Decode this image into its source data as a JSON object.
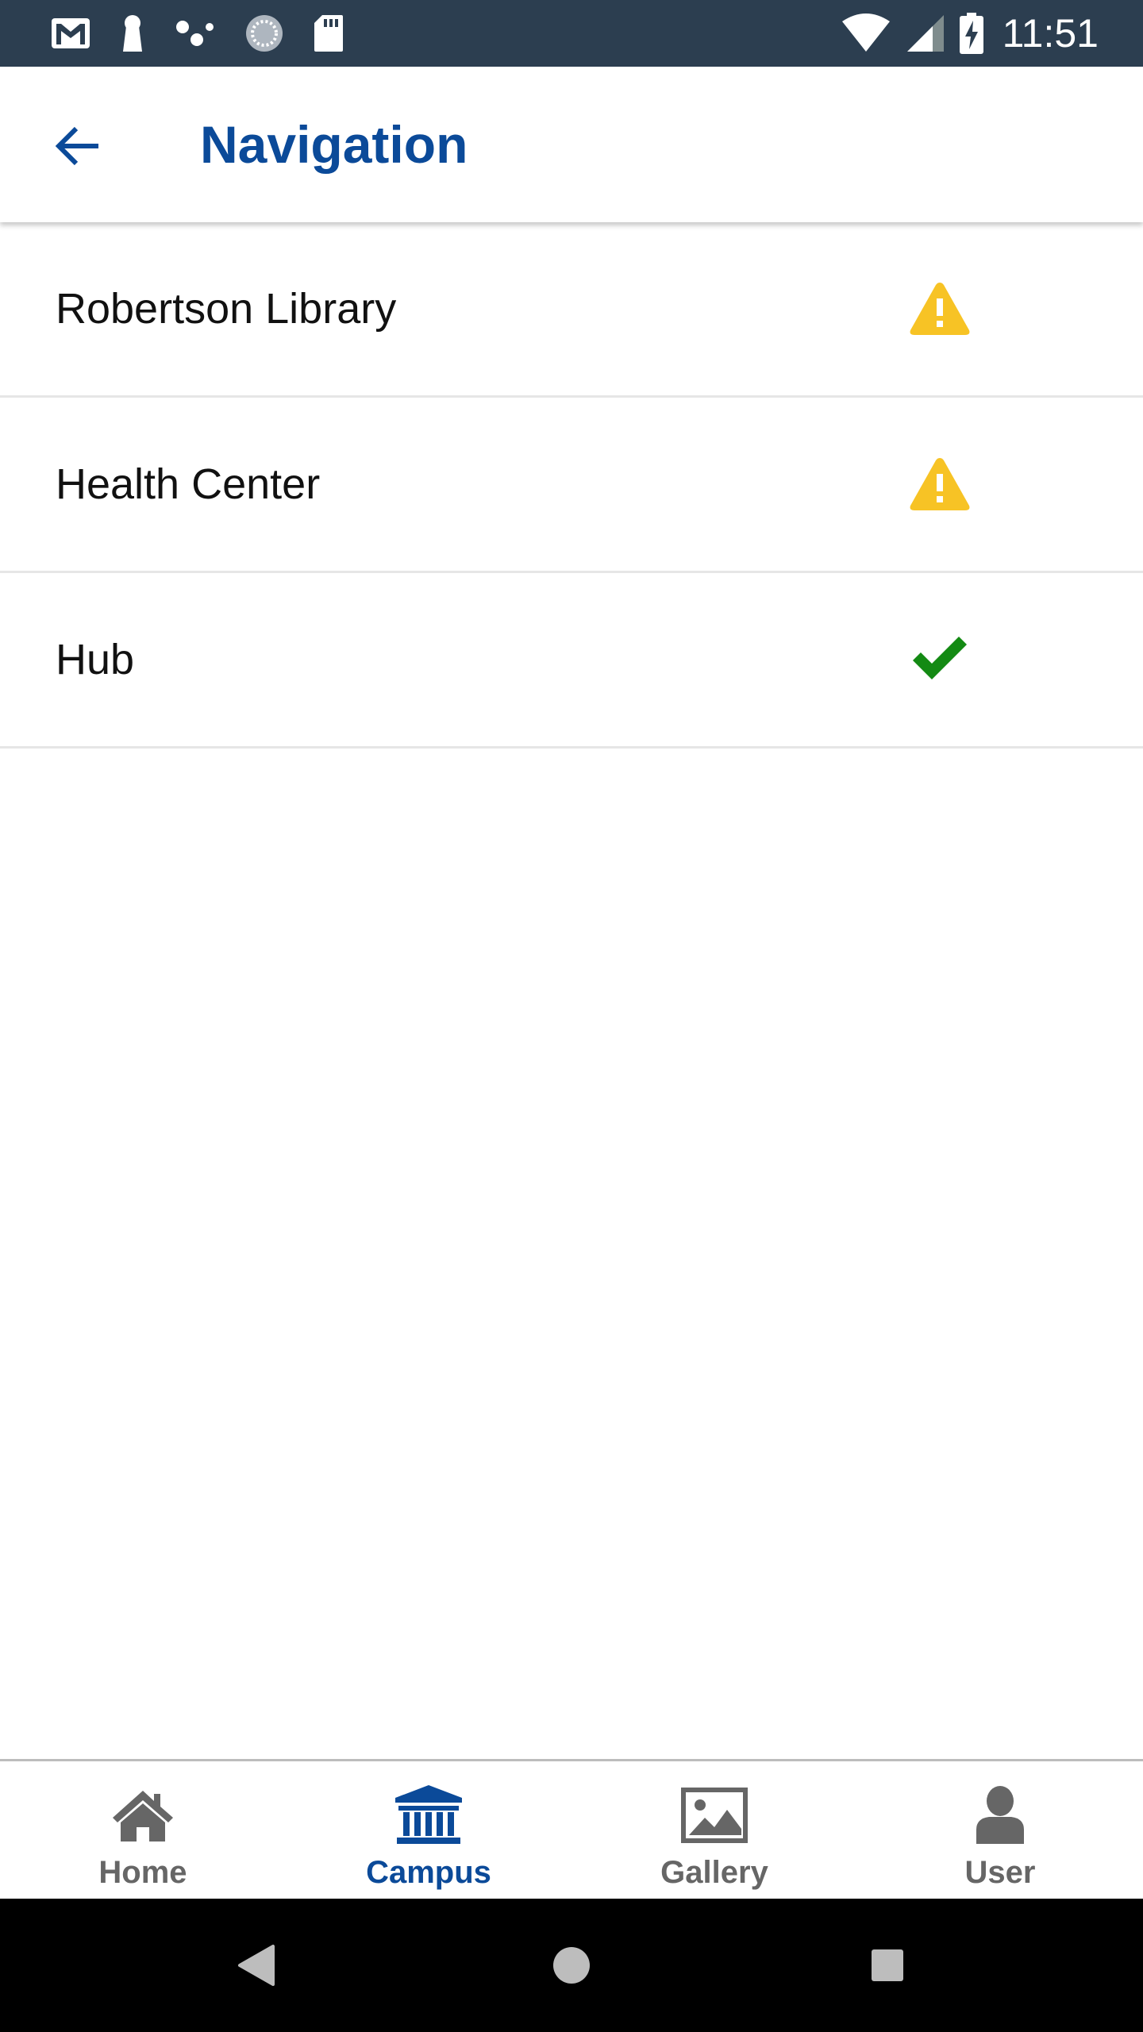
{
  "status_bar": {
    "time": "11:51",
    "left_icons": [
      "gmail-icon",
      "keyhole-icon",
      "dots-icon",
      "sync-circle-icon",
      "sd-card-icon"
    ],
    "right_icons": [
      "wifi-icon",
      "cell-signal-icon",
      "battery-charging-icon"
    ],
    "background": "#2c3e50"
  },
  "app_bar": {
    "title": "Navigation",
    "back_icon": "arrow-left-icon",
    "accent": "#0b4a99"
  },
  "locations": [
    {
      "name": "Robertson Library",
      "status": "warning",
      "icon": "warning-icon"
    },
    {
      "name": "Health Center",
      "status": "warning",
      "icon": "warning-icon"
    },
    {
      "name": "Hub",
      "status": "ok",
      "icon": "check-icon"
    }
  ],
  "status_colors": {
    "warning": "#f7c325",
    "ok": "#138a13"
  },
  "bottom_nav": {
    "items": [
      {
        "label": "Home",
        "icon": "home-icon",
        "active": false
      },
      {
        "label": "Campus",
        "icon": "campus-building-icon",
        "active": true
      },
      {
        "label": "Gallery",
        "icon": "image-icon",
        "active": false
      },
      {
        "label": "User",
        "icon": "user-icon",
        "active": false
      }
    ],
    "active_color": "#0b4a99",
    "inactive_color": "#666666"
  },
  "system_nav": {
    "buttons": [
      "back-triangle-icon",
      "home-circle-icon",
      "recents-square-icon"
    ]
  }
}
